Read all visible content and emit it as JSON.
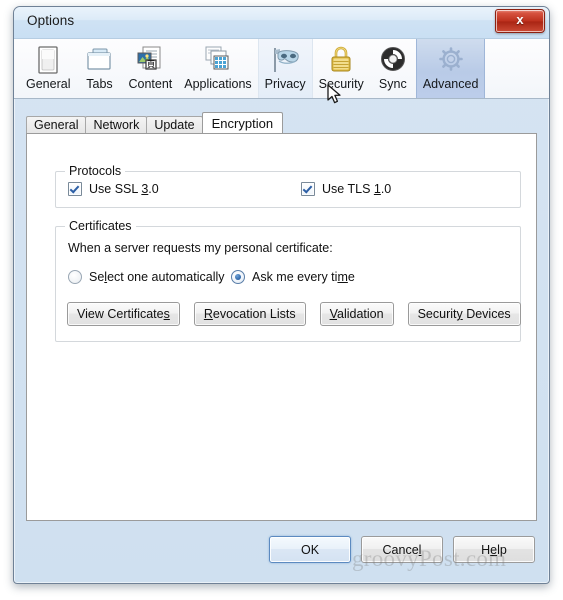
{
  "window": {
    "title": "Options",
    "close_label": "x"
  },
  "toolbar": {
    "items": [
      {
        "label": "General",
        "icon": "general-icon",
        "state": "normal"
      },
      {
        "label": "Tabs",
        "icon": "tabs-icon",
        "state": "normal"
      },
      {
        "label": "Content",
        "icon": "content-icon",
        "state": "normal"
      },
      {
        "label": "Applications",
        "icon": "applications-icon",
        "state": "normal"
      },
      {
        "label": "Privacy",
        "icon": "privacy-mask-icon",
        "state": "hover"
      },
      {
        "label": "Security",
        "icon": "padlock-icon",
        "state": "normal"
      },
      {
        "label": "Sync",
        "icon": "sync-icon",
        "state": "normal"
      },
      {
        "label": "Advanced",
        "icon": "gear-icon",
        "state": "selected"
      }
    ]
  },
  "tabs": {
    "items": [
      {
        "label": "General",
        "active": false
      },
      {
        "label": "Network",
        "active": false
      },
      {
        "label": "Update",
        "active": false
      },
      {
        "label": "Encryption",
        "active": true
      }
    ]
  },
  "protocols": {
    "group_title": "Protocols",
    "ssl": {
      "label_before": "Use SSL ",
      "label_accel": "3",
      "label_after": ".0",
      "checked": true
    },
    "tls": {
      "label_before": "Use TLS ",
      "label_accel": "1",
      "label_after": ".0",
      "checked": true
    }
  },
  "certificates": {
    "group_title": "Certificates",
    "prompt": "When a server requests my personal certificate:",
    "options": [
      {
        "label_before": "Se",
        "label_accel": "l",
        "label_after": "ect one automatically",
        "selected": false
      },
      {
        "label_before": "Ask me every ti",
        "label_accel": "m",
        "label_after": "e",
        "selected": true
      }
    ],
    "buttons": [
      {
        "before": "View Certificate",
        "accel": "s",
        "after": ""
      },
      {
        "before": "",
        "accel": "R",
        "after": "evocation Lists"
      },
      {
        "before": "",
        "accel": "V",
        "after": "alidation"
      },
      {
        "before": "Securit",
        "accel": "y",
        "after": " Devices"
      }
    ]
  },
  "dialog_buttons": [
    {
      "before": "OK",
      "accel": "",
      "after": "",
      "default": true
    },
    {
      "before": "Cance",
      "accel": "l",
      "after": "",
      "default": false
    },
    {
      "before": "H",
      "accel": "e",
      "after": "lp",
      "default": false
    }
  ],
  "watermark": {
    "text": "groovyPost.com"
  },
  "colors": {
    "accent_selected_tab": "#b9cbe7",
    "close_button": "#bc2f1c",
    "default_button_border": "#5c8ac0",
    "radio_fill": "#2f66a8",
    "check_mark": "#2d5fa6"
  }
}
